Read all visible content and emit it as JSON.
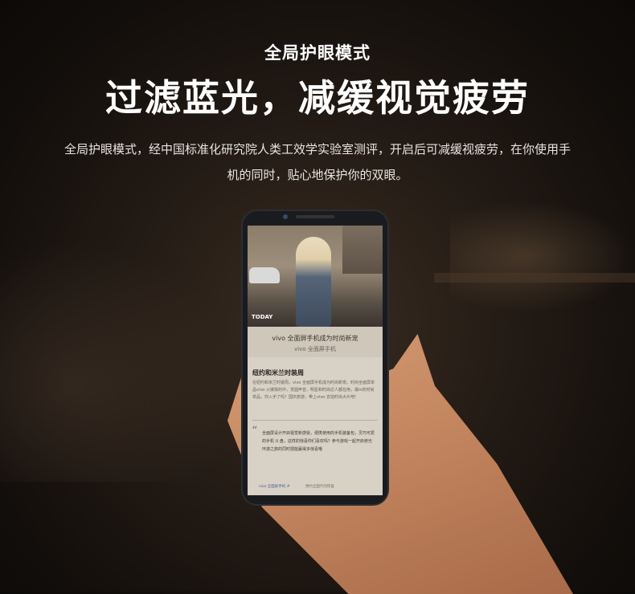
{
  "header": {
    "subtitle": "全局护眼模式",
    "title": "过滤蓝光，减缓视觉疲劳",
    "description": "全局护眼模式，经中国标准化研究院人类工效学实验室测评，开启后可减缓视疲劳，在你使用手机的同时，贴心地保护你的双眼。"
  },
  "phone_screen": {
    "photo_label": "TODAY",
    "card_title": "vivo 全面屏手机成为时尚新宠",
    "card_subtitle": "vivo 全面屏手机",
    "article_title": "纽约和米兰时装周",
    "article_body": "在纽约和米兰时装周，vivo 全面屏手机成为时尚新宠。时尚全面屏单品vivo 火爆我的中，觉圆声音，明星和时尚达人都在用，最in的时尚单品，你入手了吗？国庆旅游，带上vivo 去拍时尚大片吧!",
    "quote_mark": "“",
    "quote_body": "全面屏设计开启视觉新感受，便携使用的手机装备包，灵巧可爱的手机 U 盘，这样的惊喜你们喜欢吗？参与游戏一起开启使光环游之旅的同时把能赢得多惊喜哦",
    "quote_tag": "vivo 全面屏手机 #",
    "quote_meta": "预约全面代的惊喜"
  }
}
